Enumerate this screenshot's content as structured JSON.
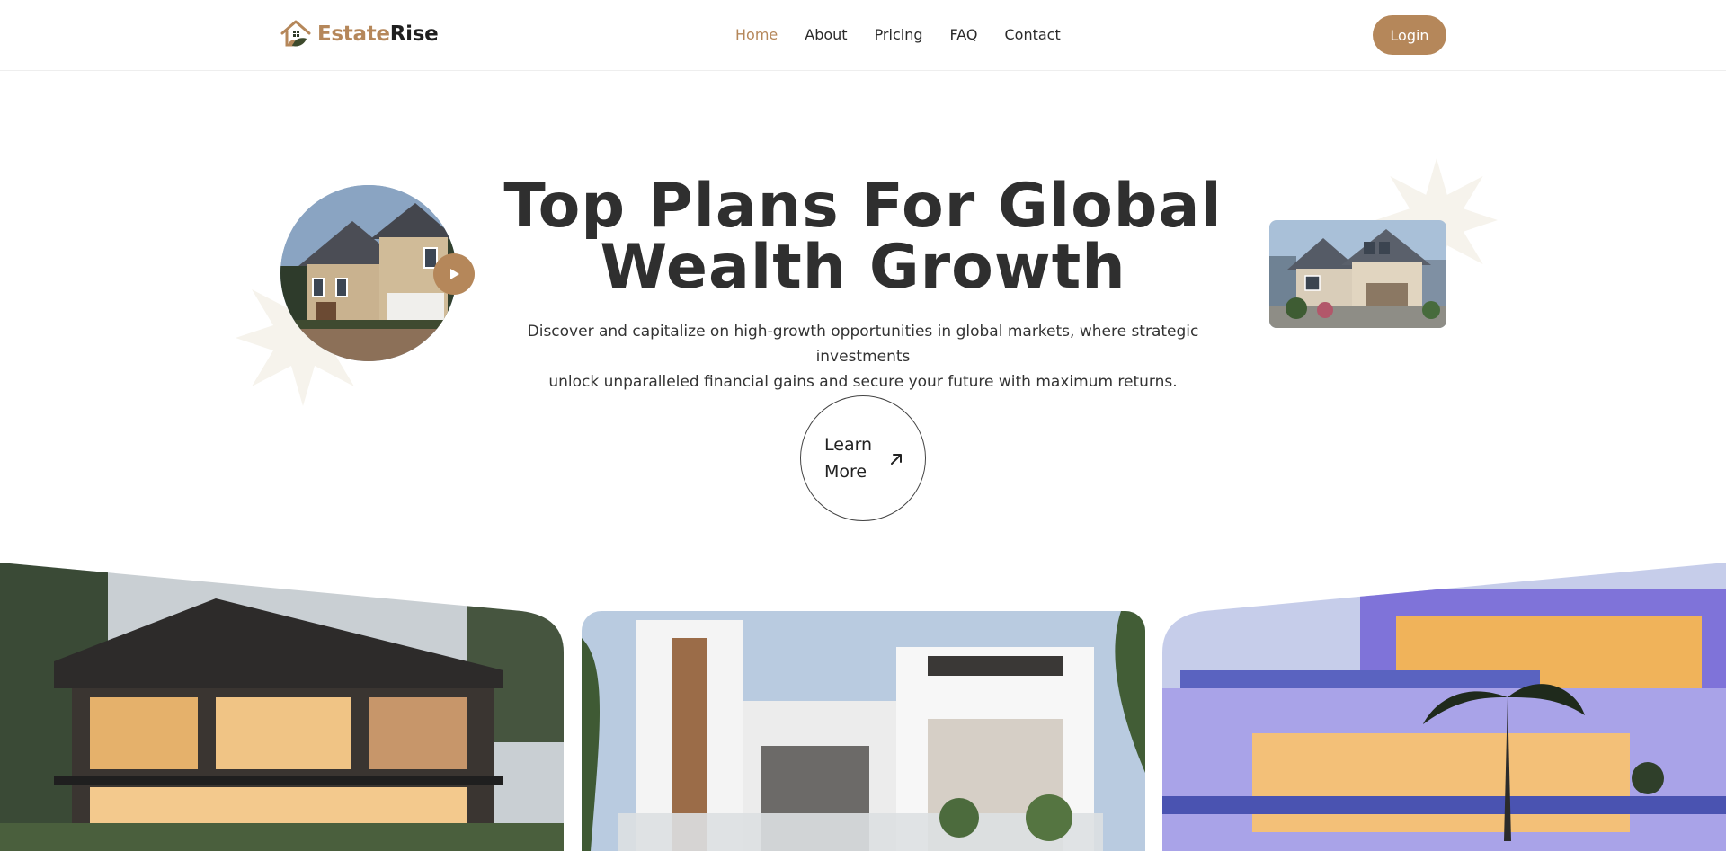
{
  "brand": {
    "name_part1": "Estate",
    "name_part2": "Rise",
    "accent_color": "#b5875a",
    "logo_icon": "house-leaf-icon"
  },
  "nav": {
    "items": [
      {
        "label": "Home",
        "active": true
      },
      {
        "label": "About",
        "active": false
      },
      {
        "label": "Pricing",
        "active": false
      },
      {
        "label": "FAQ",
        "active": false
      },
      {
        "label": "Contact",
        "active": false
      }
    ],
    "login_label": "Login"
  },
  "hero": {
    "title_line1": "Top Plans For Global",
    "title_line2": "Wealth Growth",
    "subtitle_line1": "Discover and capitalize on high-growth opportunities in global markets, where strategic investments",
    "subtitle_line2": "unlock unparalleled financial gains and secure your future with maximum returns.",
    "cta_label": "Learn More",
    "cta_icon": "arrow-up-right-icon",
    "play_icon": "play-icon"
  }
}
